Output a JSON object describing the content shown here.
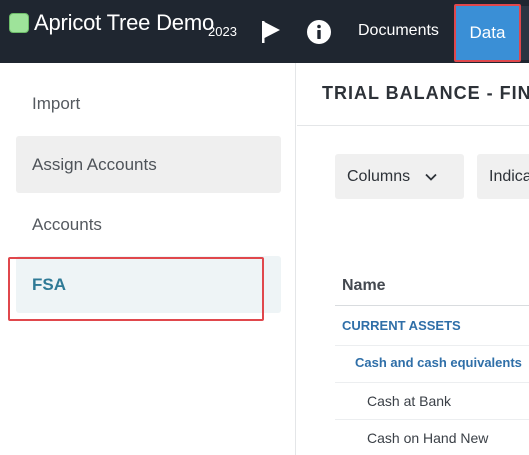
{
  "app": {
    "title": "Apricot Tree Demo",
    "year": "2023",
    "status_color": "#9ee39a"
  },
  "topnav": {
    "flag_icon": "flag-icon",
    "info_icon": "info-icon",
    "documents_label": "Documents",
    "data_label": "Data",
    "active": "Data",
    "active_color": "#3a8fd6"
  },
  "sidebar": {
    "items": [
      {
        "label": "Import"
      },
      {
        "label": "Assign Accounts"
      },
      {
        "label": "Accounts"
      },
      {
        "label": "FSA"
      }
    ],
    "active": "FSA"
  },
  "main": {
    "title": "TRIAL BALANCE - FIN",
    "columns_button": "Columns",
    "indicators_button": "Indica",
    "table": {
      "header_name": "Name",
      "rows": [
        {
          "label": "CURRENT ASSETS",
          "level": 0
        },
        {
          "label": "Cash and cash equivalents",
          "level": 1
        },
        {
          "label": "Cash at Bank",
          "level": 2
        },
        {
          "label": "Cash on Hand New",
          "level": 2
        }
      ]
    }
  },
  "highlight_color": "#e0474c"
}
